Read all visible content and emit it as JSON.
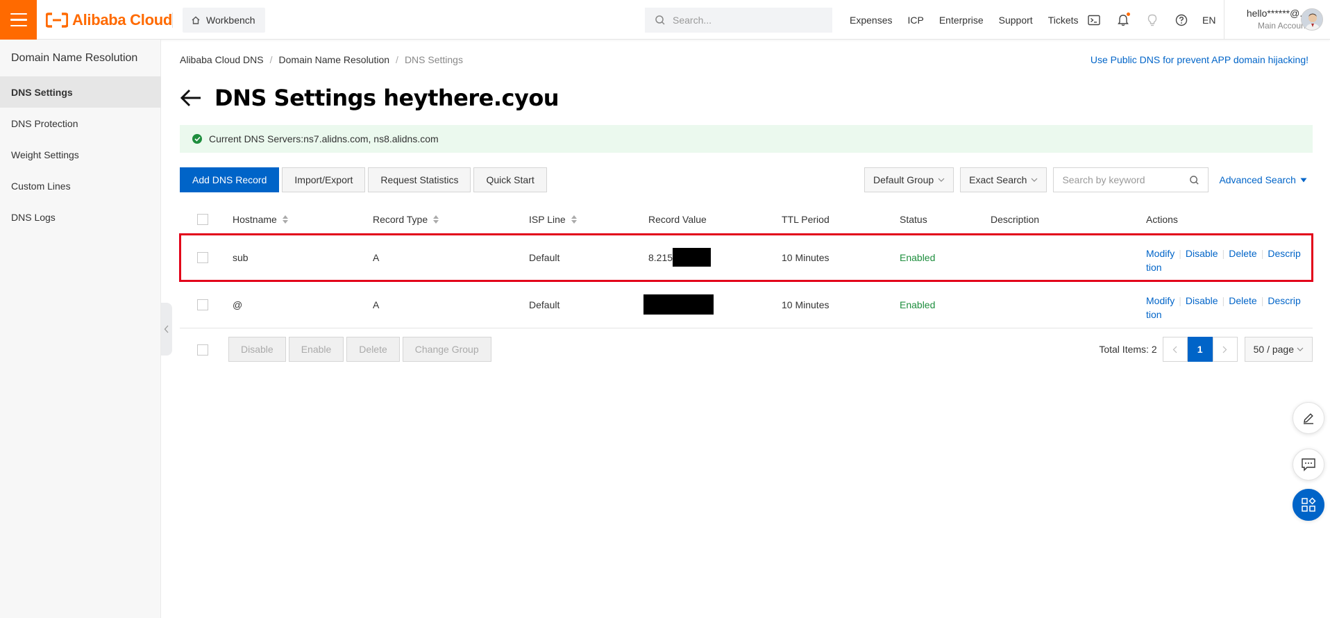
{
  "header": {
    "logo_text": "Alibaba Cloud",
    "workbench_label": "Workbench",
    "search_placeholder": "Search...",
    "nav": [
      "Expenses",
      "ICP",
      "Enterprise",
      "Support",
      "Tickets"
    ],
    "lang": "EN",
    "account_name": "hello******@...",
    "account_sub": "Main Account",
    "accent_color": "#ff6a00"
  },
  "sidebar": {
    "title": "Domain Name Resolution",
    "items": [
      {
        "label": "DNS Settings",
        "active": true
      },
      {
        "label": "DNS Protection"
      },
      {
        "label": "Weight Settings"
      },
      {
        "label": "Custom Lines"
      },
      {
        "label": "DNS Logs"
      }
    ]
  },
  "breadcrumb": [
    "Alibaba Cloud DNS",
    "Domain Name Resolution",
    "DNS Settings"
  ],
  "promo_link": "Use Public DNS for prevent APP domain hijacking!",
  "page_title": "DNS Settings heythere.cyou",
  "dns_banner": "Current DNS Servers:ns7.alidns.com, ns8.alidns.com",
  "toolbar": {
    "add": "Add DNS Record",
    "import_export": "Import/Export",
    "stats": "Request Statistics",
    "quick_start": "Quick Start"
  },
  "filters": {
    "group": "Default Group",
    "search_mode": "Exact Search",
    "keyword_placeholder": "Search by keyword",
    "advanced": "Advanced Search"
  },
  "table": {
    "columns": [
      "Hostname",
      "Record Type",
      "ISP Line",
      "Record Value",
      "TTL Period",
      "Status",
      "Description",
      "Actions"
    ],
    "rows": [
      {
        "hostname": "sub",
        "type": "A",
        "line": "Default",
        "value": "8.215",
        "ttl": "10 Minutes",
        "status": "Enabled",
        "description": "",
        "highlighted": true
      },
      {
        "hostname": "@",
        "type": "A",
        "line": "Default",
        "value": "",
        "ttl": "10 Minutes",
        "status": "Enabled",
        "description": ""
      }
    ],
    "actions": [
      "Modify",
      "Disable",
      "Delete",
      "Descrip",
      "tion"
    ]
  },
  "footer": {
    "bulk": [
      "Disable",
      "Enable",
      "Delete",
      "Change Group"
    ],
    "total": "Total Items: 2",
    "current_page": "1",
    "page_size": "50 / page"
  }
}
